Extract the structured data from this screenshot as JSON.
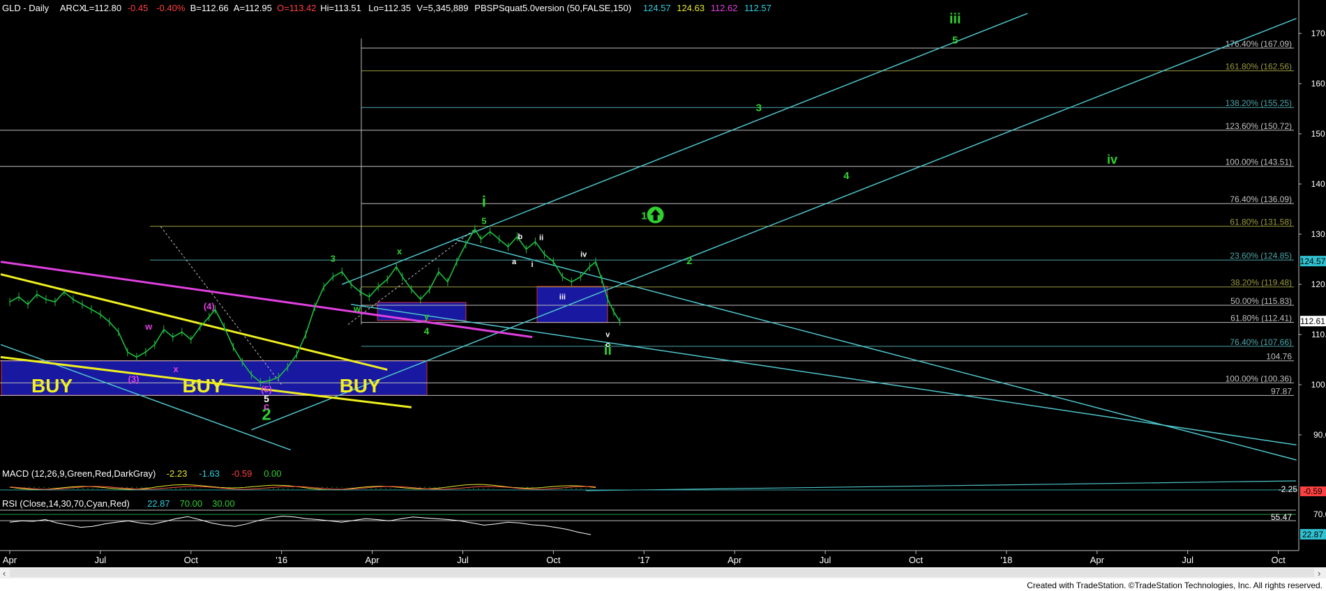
{
  "header": [
    {
      "text": "GLD - Daily",
      "color": "#ffffff"
    },
    {
      "text": "ARCX",
      "color": "#ffffff"
    },
    {
      "text": "L=112.80",
      "color": "#ffffff"
    },
    {
      "text": "-0.45",
      "color": "#ff4040"
    },
    {
      "text": "-0.40%",
      "color": "#ff4040"
    },
    {
      "text": "B=112.66",
      "color": "#ffffff"
    },
    {
      "text": "A=112.95",
      "color": "#ffffff"
    },
    {
      "text": "O=113.42",
      "color": "#ff4040"
    },
    {
      "text": "Hi=113.51",
      "color": "#ffffff"
    },
    {
      "text": "Lo=112.35",
      "color": "#ffffff"
    },
    {
      "text": "V=5,345,889",
      "color": "#ffffff"
    },
    {
      "text": "PBSPSquat5.0version (50,FALSE,150)",
      "color": "#ffffff"
    },
    {
      "text": "124.57",
      "color": "#30d0e0"
    },
    {
      "text": "124.63",
      "color": "#e8e830"
    },
    {
      "text": "112.62",
      "color": "#e040e0"
    },
    {
      "text": "112.57",
      "color": "#30d0e0"
    }
  ],
  "chart_data": {
    "type": "line",
    "title": "GLD - Daily",
    "price_ylim": [
      85,
      175
    ],
    "price_yticks": [
      90,
      100,
      110,
      120,
      130,
      140,
      150,
      160,
      170
    ],
    "x_ticks": [
      {
        "label": "Apr",
        "t": 0
      },
      {
        "label": "Jul",
        "t": 3
      },
      {
        "label": "Oct",
        "t": 6
      },
      {
        "label": "'16",
        "t": 9
      },
      {
        "label": "Apr",
        "t": 12
      },
      {
        "label": "Jul",
        "t": 15
      },
      {
        "label": "Oct",
        "t": 18
      },
      {
        "label": "'17",
        "t": 21
      },
      {
        "label": "Apr",
        "t": 24
      },
      {
        "label": "Jul",
        "t": 27
      },
      {
        "label": "Oct",
        "t": 30
      },
      {
        "label": "'18",
        "t": 33
      },
      {
        "label": "Apr",
        "t": 36
      },
      {
        "label": "Jul",
        "t": 39
      },
      {
        "label": "Oct",
        "t": 42
      }
    ],
    "price_series": [
      [
        0.0,
        116.5
      ],
      [
        0.3,
        117.5
      ],
      [
        0.6,
        116.0
      ],
      [
        0.9,
        118.0
      ],
      [
        1.2,
        117.0
      ],
      [
        1.5,
        116.5
      ],
      [
        1.8,
        118.5
      ],
      [
        2.1,
        117.0
      ],
      [
        2.4,
        116.0
      ],
      [
        2.7,
        115.0
      ],
      [
        3.0,
        114.0
      ],
      [
        3.3,
        112.5
      ],
      [
        3.6,
        110.5
      ],
      [
        3.9,
        106.5
      ],
      [
        4.2,
        105.5
      ],
      [
        4.5,
        106.5
      ],
      [
        4.8,
        108.0
      ],
      [
        5.1,
        111.0
      ],
      [
        5.4,
        109.5
      ],
      [
        5.7,
        110.5
      ],
      [
        6.0,
        109.0
      ],
      [
        6.3,
        111.5
      ],
      [
        6.6,
        113.5
      ],
      [
        6.8,
        115.0
      ],
      [
        7.1,
        111.5
      ],
      [
        7.4,
        107.5
      ],
      [
        7.7,
        104.5
      ],
      [
        8.0,
        102.0
      ],
      [
        8.3,
        100.5
      ],
      [
        8.6,
        100.8
      ],
      [
        8.9,
        101.5
      ],
      [
        9.2,
        103.5
      ],
      [
        9.5,
        106.0
      ],
      [
        9.8,
        110.0
      ],
      [
        10.1,
        115.5
      ],
      [
        10.4,
        119.5
      ],
      [
        10.7,
        121.5
      ],
      [
        11.0,
        122.5
      ],
      [
        11.3,
        120.0
      ],
      [
        11.6,
        118.5
      ],
      [
        11.9,
        117.5
      ],
      [
        12.2,
        119.5
      ],
      [
        12.5,
        121.0
      ],
      [
        12.8,
        123.5
      ],
      [
        13.0,
        121.5
      ],
      [
        13.3,
        119.0
      ],
      [
        13.6,
        117.0
      ],
      [
        13.9,
        119.0
      ],
      [
        14.2,
        122.5
      ],
      [
        14.5,
        120.5
      ],
      [
        14.8,
        124.5
      ],
      [
        15.1,
        128.0
      ],
      [
        15.4,
        131.0
      ],
      [
        15.6,
        129.0
      ],
      [
        15.9,
        130.5
      ],
      [
        16.2,
        129.0
      ],
      [
        16.5,
        127.5
      ],
      [
        16.8,
        129.5
      ],
      [
        17.1,
        127.0
      ],
      [
        17.4,
        128.5
      ],
      [
        17.7,
        126.0
      ],
      [
        18.0,
        124.5
      ],
      [
        18.3,
        121.5
      ],
      [
        18.6,
        120.5
      ],
      [
        18.9,
        121.5
      ],
      [
        19.2,
        123.5
      ],
      [
        19.4,
        124.5
      ],
      [
        19.6,
        121.0
      ],
      [
        19.8,
        117.0
      ],
      [
        20.0,
        114.5
      ],
      [
        20.2,
        112.6
      ]
    ],
    "fib_levels": [
      {
        "label": "176.40% (167.09)",
        "value": 167.09
      },
      {
        "label": "161.80% (162.56)",
        "value": 162.56
      },
      {
        "label": "138.20% (155.25)",
        "value": 155.25
      },
      {
        "label": "123.60% (150.72)",
        "value": 150.72
      },
      {
        "label": "100.00% (143.51)",
        "value": 143.51
      },
      {
        "label": "76.40% (136.09)",
        "value": 136.09
      },
      {
        "label": "61.80% (131.58)",
        "value": 131.58
      },
      {
        "label": "23.60% (124.85)",
        "value": 124.85
      },
      {
        "label": "38.20% (119.48)",
        "value": 119.48
      },
      {
        "label": "50.00% (115.83)",
        "value": 115.83
      },
      {
        "label": "61.80% (112.41)",
        "value": 112.41
      },
      {
        "label": "76.40% (107.66)",
        "value": 107.66
      },
      {
        "label": "104.76",
        "value": 104.76
      },
      {
        "label": "100.00% (100.36)",
        "value": 100.36
      },
      {
        "label": "97.87",
        "value": 97.87
      }
    ],
    "price_axis_markers": [
      {
        "label": "124.57",
        "value": 124.57,
        "color": "#30d0e0"
      },
      {
        "label": "112.61",
        "value": 112.61,
        "color": "#ffffff"
      }
    ],
    "wave_labels": [
      {
        "text": "iii",
        "t": 31.3,
        "v": 172.0,
        "color": "#30d030",
        "size": 20
      },
      {
        "text": "5",
        "t": 31.3,
        "v": 168.0,
        "color": "#30d030",
        "size": 15
      },
      {
        "text": "3",
        "t": 24.8,
        "v": 154.5,
        "color": "#30d030",
        "size": 15
      },
      {
        "text": "4",
        "t": 27.7,
        "v": 141.0,
        "color": "#30d030",
        "size": 15
      },
      {
        "text": "iv",
        "t": 36.5,
        "v": 144.0,
        "color": "#30d030",
        "size": 18
      },
      {
        "text": "1",
        "t": 21.0,
        "v": 133.0,
        "color": "#30d030",
        "size": 15
      },
      {
        "text": "2",
        "t": 22.5,
        "v": 124.0,
        "color": "#30d030",
        "size": 15
      },
      {
        "text": "i",
        "t": 15.7,
        "v": 135.5,
        "color": "#30d030",
        "size": 22
      },
      {
        "text": "5",
        "t": 15.7,
        "v": 132.0,
        "color": "#30d030",
        "size": 13
      },
      {
        "text": "3",
        "t": 10.7,
        "v": 124.5,
        "color": "#30d030",
        "size": 13
      },
      {
        "text": "x",
        "t": 12.9,
        "v": 126.0,
        "color": "#30d030",
        "size": 13
      },
      {
        "text": "w",
        "t": 11.5,
        "v": 114.5,
        "color": "#30d030",
        "size": 13
      },
      {
        "text": "y",
        "t": 13.8,
        "v": 113.0,
        "color": "#30d030",
        "size": 13
      },
      {
        "text": "4",
        "t": 13.8,
        "v": 110.0,
        "color": "#30d030",
        "size": 14
      },
      {
        "text": "ii",
        "t": 19.8,
        "v": 106.0,
        "color": "#30d030",
        "size": 20
      },
      {
        "text": "2",
        "t": 8.5,
        "v": 93.0,
        "color": "#30d030",
        "size": 24
      },
      {
        "text": "b",
        "t": 16.9,
        "v": 129.0,
        "color": "#ffffff",
        "size": 11
      },
      {
        "text": "ii",
        "t": 17.6,
        "v": 128.8,
        "color": "#ffffff",
        "size": 11
      },
      {
        "text": "a",
        "t": 16.7,
        "v": 124.0,
        "color": "#ffffff",
        "size": 11
      },
      {
        "text": "i",
        "t": 17.3,
        "v": 123.5,
        "color": "#ffffff",
        "size": 11
      },
      {
        "text": "iv",
        "t": 19.0,
        "v": 125.5,
        "color": "#ffffff",
        "size": 11
      },
      {
        "text": "iii",
        "t": 18.3,
        "v": 117.0,
        "color": "#ffffff",
        "size": 11
      },
      {
        "text": "v",
        "t": 19.8,
        "v": 109.5,
        "color": "#ffffff",
        "size": 11
      },
      {
        "text": "c",
        "t": 19.8,
        "v": 107.5,
        "color": "#ffffff",
        "size": 11
      },
      {
        "text": "(4)",
        "t": 6.6,
        "v": 115.0,
        "color": "#e040e0",
        "size": 13
      },
      {
        "text": "w",
        "t": 4.6,
        "v": 111.0,
        "color": "#e040e0",
        "size": 13
      },
      {
        "text": "x",
        "t": 5.5,
        "v": 102.5,
        "color": "#e040e0",
        "size": 13
      },
      {
        "text": "(3)",
        "t": 4.1,
        "v": 100.5,
        "color": "#e040e0",
        "size": 13
      },
      {
        "text": "(5)",
        "t": 8.5,
        "v": 98.5,
        "color": "#e040e0",
        "size": 13
      },
      {
        "text": "5",
        "t": 8.5,
        "v": 96.5,
        "color": "#ffffff",
        "size": 14
      },
      {
        "text": "c",
        "t": 8.5,
        "v": 95.0,
        "color": "#e040e0",
        "size": 15
      }
    ],
    "buy_labels": [
      {
        "text": "BUY",
        "t": 1.4,
        "v": 98.5
      },
      {
        "text": "BUY",
        "t": 6.4,
        "v": 98.5
      },
      {
        "text": "BUY",
        "t": 11.6,
        "v": 98.5
      }
    ],
    "up_arrow": {
      "t": 21.1,
      "v": 133.0
    },
    "macd": {
      "label": "MACD (12,26,9,Green,Red,DarkGray)",
      "values": [
        "-2.23",
        "-1.63",
        "-0.59",
        "0.00"
      ],
      "value_colors": [
        "#e8e830",
        "#30d0e0",
        "#ff4040",
        "#30d030"
      ],
      "axis_labels": [
        "-2.25",
        "-0.59"
      ]
    },
    "rsi": {
      "label": "RSI (Close,14,30,70,Cyan,Red)",
      "values": [
        "22.87",
        "70.00",
        "30.00"
      ],
      "value_colors": [
        "#30d0e0",
        "#30d030",
        "#30d030"
      ],
      "yticks": [
        "70.00"
      ],
      "side_labels": [
        "55.47"
      ],
      "axis_marker": "22.87",
      "series": [
        52,
        55,
        54,
        58,
        50,
        45,
        40,
        42,
        48,
        52,
        55,
        50,
        47,
        53,
        60,
        65,
        58,
        50,
        45,
        42,
        48,
        56,
        62,
        66,
        64,
        60,
        58,
        55,
        52,
        56,
        60,
        58,
        55,
        60,
        64,
        62,
        60,
        58,
        55,
        50,
        45,
        48,
        52,
        50,
        46,
        44,
        40,
        35,
        28,
        22.87
      ]
    },
    "footer": "Created with TradeStation. ©TradeStation Technologies, Inc. All rights reserved.",
    "colors": {
      "background": "#000000",
      "channel": "#4fc6cc",
      "magenta": "#e040e0",
      "yellow": "#f0f020",
      "box": "#1818a0",
      "green": "#30d030",
      "fib_gray": "#c0c0c0",
      "fib_olive": "#9a9a40",
      "fib_teal": "#4fa6aa"
    }
  }
}
